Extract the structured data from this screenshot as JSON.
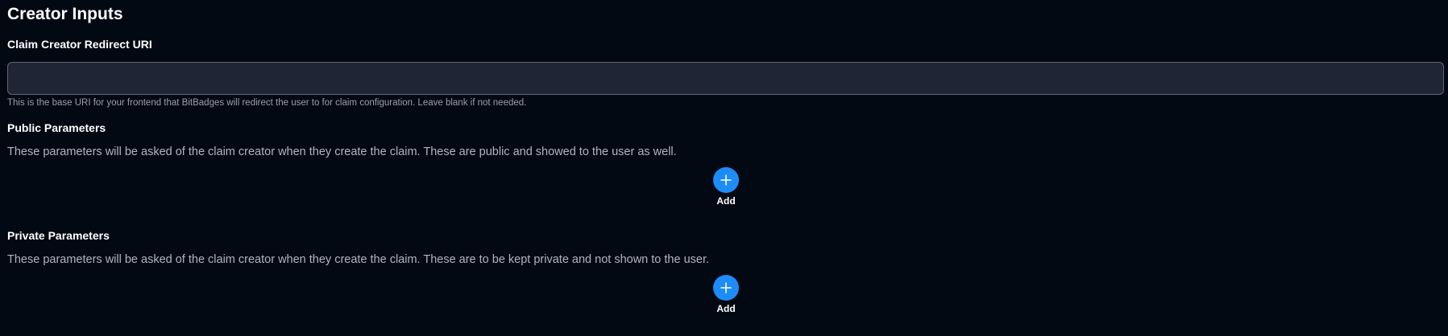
{
  "section_title": "Creator Inputs",
  "redirect": {
    "label": "Claim Creator Redirect URI",
    "value": "",
    "placeholder": "",
    "help": "This is the base URI for your frontend that BitBadges will redirect the user to for claim configuration. Leave blank if not needed."
  },
  "public_params": {
    "label": "Public Parameters",
    "description": "These parameters will be asked of the claim creator when they create the claim. These are public and showed to the user as well.",
    "add_label": "Add",
    "add_icon": "plus-icon"
  },
  "private_params": {
    "label": "Private Parameters",
    "description": "These parameters will be asked of the claim creator when they create the claim. These are to be kept private and not shown to the user.",
    "add_label": "Add",
    "add_icon": "plus-icon"
  },
  "colors": {
    "background": "#030913",
    "accent": "#1d8cf8",
    "input_bg": "#1e2635"
  }
}
